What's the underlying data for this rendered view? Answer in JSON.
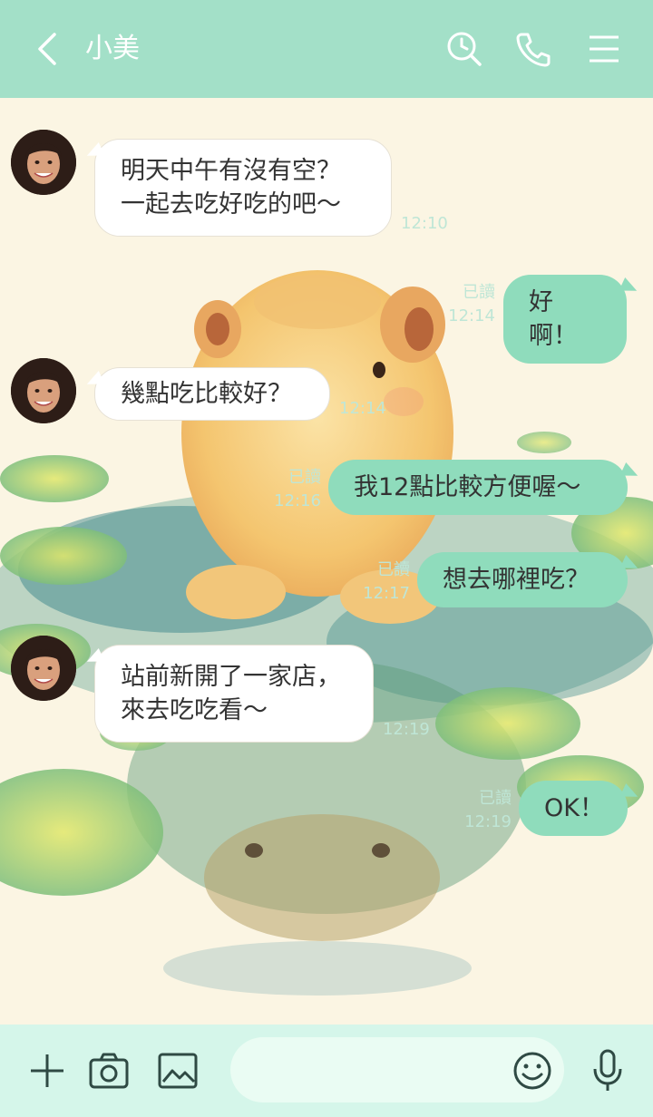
{
  "header": {
    "title": "小美"
  },
  "messages": [
    {
      "side": "in",
      "lines": [
        "明天中午有沒有空？",
        "一起去吃好吃的吧～"
      ],
      "time": "12:10"
    },
    {
      "side": "out",
      "text": "好啊！",
      "read": "已讀",
      "time": "12:14"
    },
    {
      "side": "in",
      "lines": [
        "幾點吃比較好？"
      ],
      "time": "12:14"
    },
    {
      "side": "out",
      "text": "我12點比較方便喔～",
      "read": "已讀",
      "time": "12:16"
    },
    {
      "side": "out",
      "text": "想去哪裡吃？",
      "read": "已讀",
      "time": "12:17"
    },
    {
      "side": "in",
      "lines": [
        "站前新開了一家店，",
        "來去吃吃看～"
      ],
      "time": "12:19"
    },
    {
      "side": "out",
      "text": "OK！",
      "read": "已讀",
      "time": "12:19"
    }
  ],
  "icons": {
    "back": "chevron-left-icon",
    "search": "search-clock-icon",
    "call": "phone-icon",
    "menu": "hamburger-menu-icon",
    "plus": "plus-icon",
    "camera": "camera-icon",
    "image": "image-icon",
    "emoji": "smiley-icon",
    "mic": "microphone-icon"
  },
  "colors": {
    "header": "#a3e0c8",
    "outgoing_bubble": "#8fdcbc",
    "incoming_bubble": "#ffffff",
    "meta_text": "#bfe6d6",
    "bottom_bar": "#d5f6ea"
  }
}
